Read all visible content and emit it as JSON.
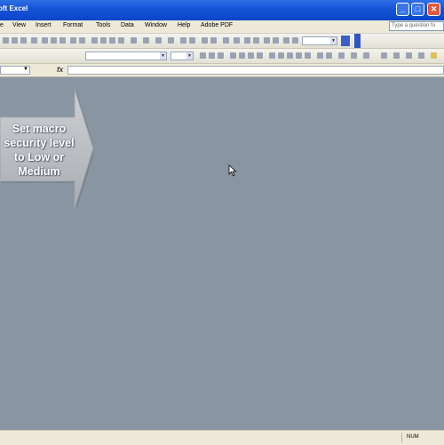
{
  "window": {
    "title": "oft Excel",
    "buttons": {
      "minimize": "_",
      "maximize": "□",
      "close": "✕"
    }
  },
  "menu": {
    "items": [
      "e",
      "View",
      "Insert",
      "Format",
      "Tools",
      "Data",
      "Window",
      "Help",
      "Adobe PDF"
    ]
  },
  "help": {
    "placeholder": "Type a question fo"
  },
  "formula_bar": {
    "name_box": "",
    "fx": "fx",
    "formula": ""
  },
  "callout": {
    "lines": [
      "Set macro",
      "security level",
      "to Low or",
      "Medium"
    ]
  },
  "status": {
    "mode": "NUM"
  },
  "icons": [
    "close-icon",
    "minimize-icon",
    "maximize-icon",
    "cursor-icon",
    "dropdown-arrow-icon"
  ],
  "colors": {
    "titlebar": "#1552d6",
    "workspace": "#8a95a2",
    "callout": "#b9bcbf"
  }
}
